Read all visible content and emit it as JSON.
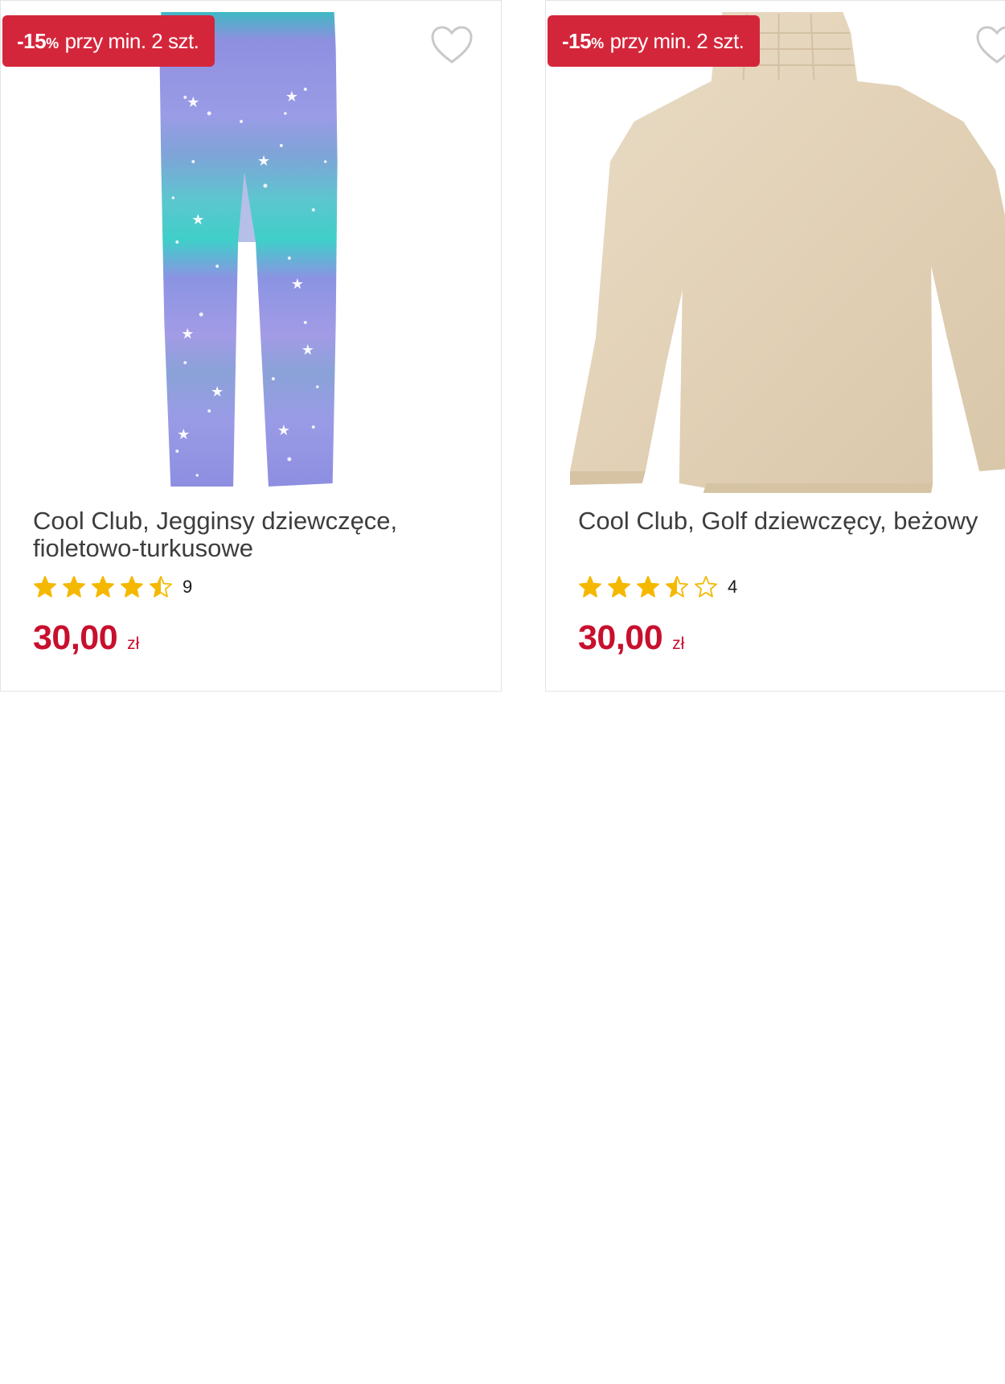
{
  "products": [
    {
      "badge_discount": "-15",
      "badge_percent": "%",
      "badge_text": "przy min. 2 szt.",
      "title": "Cool Club, Jegginsy dziewczęce, fioletowo-turkusowe",
      "rating": 4.5,
      "rating_count": "9",
      "price": "30,00",
      "currency": "zł",
      "image": "leggings-photo"
    },
    {
      "badge_discount": "-15",
      "badge_percent": "%",
      "badge_text": "przy min. 2 szt.",
      "title": "Cool Club, Golf dziewczęcy, beżowy",
      "rating": 3.5,
      "rating_count": "4",
      "price": "30,00",
      "currency": "zł",
      "image": "sweater-photo"
    }
  ],
  "icons": {
    "favorite": "heart-outline-icon",
    "rating": "star-icon"
  },
  "colors": {
    "accent_red": "#d4263b",
    "price_red": "#c8102e",
    "star_gold": "#f5b800",
    "title_gray": "#3d3d3d"
  }
}
